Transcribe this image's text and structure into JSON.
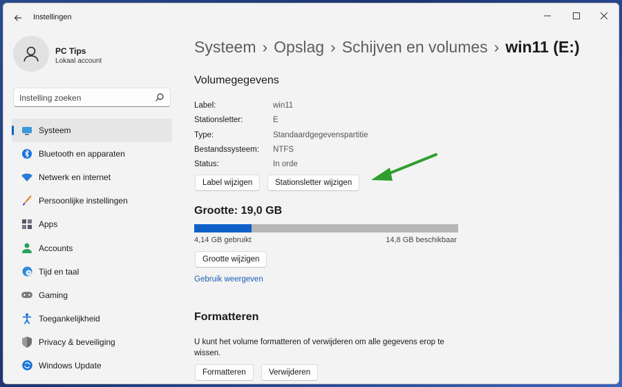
{
  "window": {
    "title": "Instellingen"
  },
  "user": {
    "name": "PC Tips",
    "account_type": "Lokaal account"
  },
  "search": {
    "placeholder": "Instelling zoeken"
  },
  "nav": [
    {
      "label": "Systeem",
      "icon": "monitor-icon",
      "active": true
    },
    {
      "label": "Bluetooth en apparaten",
      "icon": "bluetooth-icon"
    },
    {
      "label": "Netwerk en internet",
      "icon": "wifi-icon"
    },
    {
      "label": "Persoonlijke instellingen",
      "icon": "brush-icon"
    },
    {
      "label": "Apps",
      "icon": "apps-icon"
    },
    {
      "label": "Accounts",
      "icon": "person-icon"
    },
    {
      "label": "Tijd en taal",
      "icon": "globe-clock-icon"
    },
    {
      "label": "Gaming",
      "icon": "gamepad-icon"
    },
    {
      "label": "Toegankelijkheid",
      "icon": "accessibility-icon"
    },
    {
      "label": "Privacy & beveiliging",
      "icon": "shield-icon"
    },
    {
      "label": "Windows Update",
      "icon": "update-icon"
    }
  ],
  "breadcrumb": [
    "Systeem",
    "Opslag",
    "Schijven en volumes",
    "win11 (E:)"
  ],
  "volume": {
    "heading": "Volumegegevens",
    "rows": [
      {
        "label": "Label:",
        "value": "win11"
      },
      {
        "label": "Stationsletter:",
        "value": "E"
      },
      {
        "label": "Type:",
        "value": "Standaardgegevenspartitie"
      },
      {
        "label": "Bestandssysteem:",
        "value": "NTFS"
      },
      {
        "label": "Status:",
        "value": "In orde"
      }
    ],
    "btn_change_label": "Label wijzigen",
    "btn_change_letter": "Stationsletter wijzigen"
  },
  "size": {
    "heading": "Grootte: 19,0 GB",
    "used_fraction": 0.218,
    "used_label": "4,14 GB gebruikt",
    "free_label": "14,8 GB beschikbaar",
    "btn_resize": "Grootte wijzigen",
    "usage_link": "Gebruik weergeven"
  },
  "format": {
    "heading": "Formatteren",
    "description": "U kunt het volume formatteren of verwijderen om alle gegevens erop te wissen.",
    "btn_format": "Formatteren",
    "btn_delete": "Verwijderen"
  },
  "colors": {
    "accent": "#0067c0",
    "bar_used": "#0f5fc9",
    "bar_free": "#b6b6b6",
    "annotation_arrow": "#2e9e2e"
  }
}
